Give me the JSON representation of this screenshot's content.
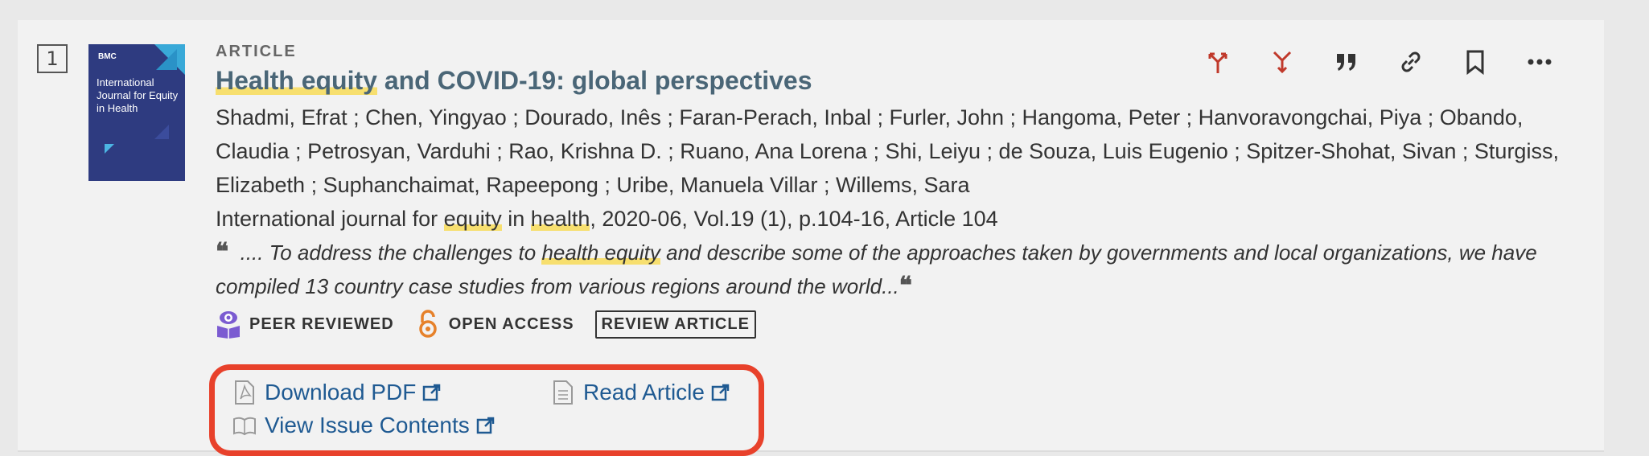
{
  "result": {
    "rank": "1",
    "thumbnail": {
      "brand": "BMC",
      "journal": "International Journal for Equity in Health"
    },
    "type": "ARTICLE",
    "title_hl1": "Health equity",
    "title_rest": " and COVID-19: global perspectives",
    "authors": "Shadmi, Efrat ; Chen, Yingyao ; Dourado, Inês ; Faran-Perach, Inbal ; Furler, John ; Hangoma, Peter ; Hanvoravongchai, Piya ; Obando, Claudia ; Petrosyan, Varduhi ; Rao, Krishna D. ; Ruano, Ana Lorena ; Shi, Leiyu ; de Souza, Luis Eugenio ; Spitzer-Shohat, Sivan ; Sturgiss, Elizabeth ; Suphanchaimat, Rapeepong ; Uribe, Manuela Villar ; Willems, Sara",
    "source": {
      "pre": "International journal for ",
      "hl1": "equity",
      "mid": " in ",
      "hl2": "health",
      "post": ", 2020-06, Vol.19 (1), p.104-16, Article 104"
    },
    "snippet": {
      "pre": ".... To address the challenges to ",
      "hl": "health equity",
      "post": " and describe some of the approaches taken by governments and local organizations, we have compiled 13 country case studies from various regions around the world..."
    },
    "badges": {
      "peer_reviewed": "PEER REVIEWED",
      "open_access": "OPEN ACCESS",
      "review_article": "REVIEW ARTICLE"
    },
    "links": {
      "download_pdf": "Download PDF",
      "read_article": "Read Article",
      "view_issue": "View Issue Contents"
    },
    "colors": {
      "highlight": "#f7df6f",
      "link": "#1f5a92",
      "focus_box": "#e8412b",
      "action_red": "#c0392b"
    },
    "action_icons": [
      "cited-by-icon",
      "citing-icon",
      "citation-icon",
      "permalink-icon",
      "bookmark-icon",
      "more-icon"
    ]
  }
}
